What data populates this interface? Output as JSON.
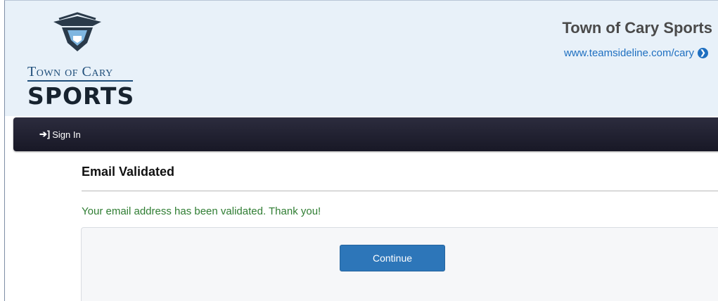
{
  "header": {
    "logo": {
      "line1": "Town of Cary",
      "line2": "Sports"
    },
    "site_title": "Town of Cary Sports",
    "site_link": "www.teamsideline.com/cary"
  },
  "navbar": {
    "signin_label": "Sign In",
    "signin_icon": "sign-in-icon"
  },
  "main": {
    "title": "Email Validated",
    "message": "Your email address has been validated. Thank you!",
    "continue_label": "Continue"
  },
  "colors": {
    "header_bg": "#e8f1f9",
    "navbar_bg": "#1f1f2e",
    "link": "#1e6fc0",
    "success": "#2f7d32",
    "button": "#2d76b9",
    "logo_dark": "#17232f",
    "logo_blue": "#1f4e7a"
  }
}
